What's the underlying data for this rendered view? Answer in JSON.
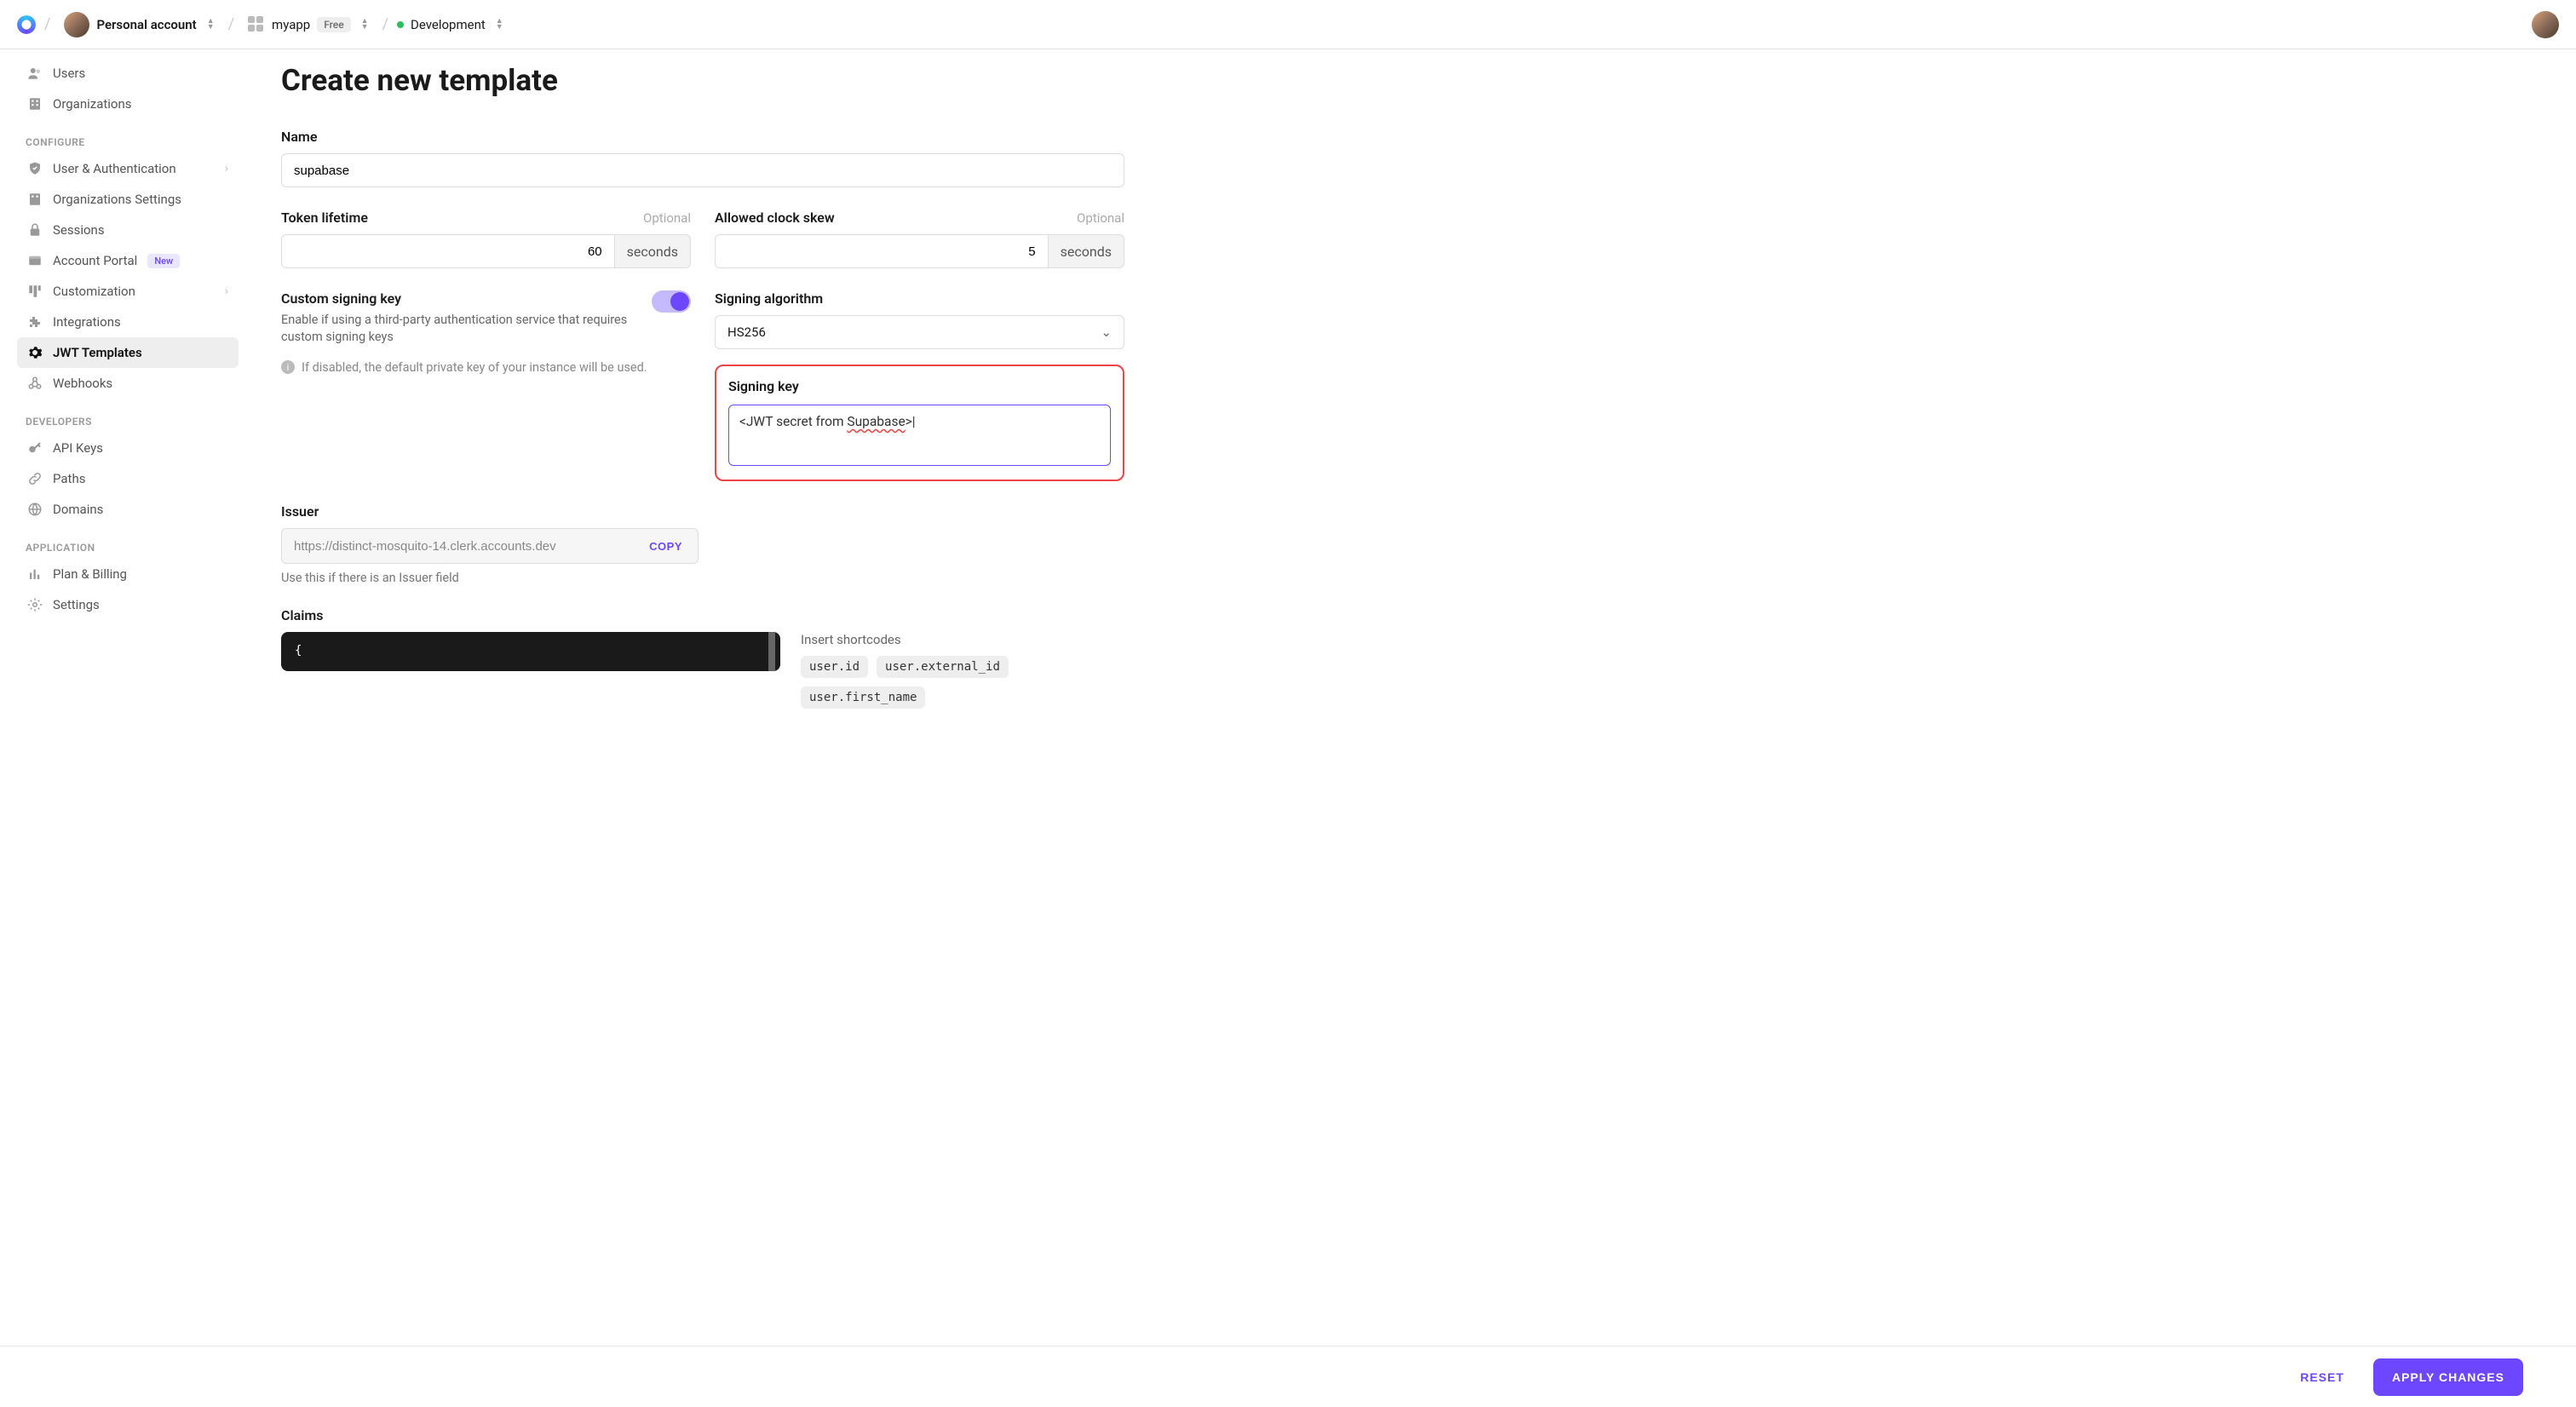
{
  "header": {
    "account_label": "Personal account",
    "app_name": "myapp",
    "app_plan": "Free",
    "environment": "Development"
  },
  "sidebar": {
    "top": [
      {
        "label": "Users",
        "icon": "users-icon"
      },
      {
        "label": "Organizations",
        "icon": "org-icon"
      }
    ],
    "configure_label": "CONFIGURE",
    "configure": [
      {
        "label": "User & Authentication",
        "icon": "shield-icon",
        "has_chevron": true
      },
      {
        "label": "Organizations Settings",
        "icon": "org-icon"
      },
      {
        "label": "Sessions",
        "icon": "lock-icon"
      },
      {
        "label": "Account Portal",
        "icon": "portal-icon",
        "badge": "New"
      },
      {
        "label": "Customization",
        "icon": "customize-icon",
        "has_chevron": true
      },
      {
        "label": "Integrations",
        "icon": "puzzle-icon"
      },
      {
        "label": "JWT Templates",
        "icon": "gear-icon",
        "active": true
      },
      {
        "label": "Webhooks",
        "icon": "webhook-icon"
      }
    ],
    "developers_label": "DEVELOPERS",
    "developers": [
      {
        "label": "API Keys",
        "icon": "key-icon"
      },
      {
        "label": "Paths",
        "icon": "link-icon"
      },
      {
        "label": "Domains",
        "icon": "globe-icon"
      }
    ],
    "application_label": "APPLICATION",
    "application": [
      {
        "label": "Plan & Billing",
        "icon": "billing-icon"
      },
      {
        "label": "Settings",
        "icon": "settings-icon"
      }
    ]
  },
  "page": {
    "title": "Create new template",
    "name_label": "Name",
    "name_value": "supabase",
    "token_lifetime_label": "Token lifetime",
    "token_lifetime_value": "60",
    "token_lifetime_unit": "seconds",
    "clock_skew_label": "Allowed clock skew",
    "clock_skew_value": "5",
    "clock_skew_unit": "seconds",
    "optional_label": "Optional",
    "custom_key_label": "Custom signing key",
    "custom_key_desc": "Enable if using a third-party authentication service that requires custom signing keys",
    "custom_key_info": "If disabled, the default private key of your instance will be used.",
    "algorithm_label": "Signing algorithm",
    "algorithm_value": "HS256",
    "signing_key_label": "Signing key",
    "signing_key_value_prefix": "<JWT secret from ",
    "signing_key_value_spell": "Supabase",
    "signing_key_value_suffix": ">",
    "issuer_label": "Issuer",
    "issuer_value": "https://distinct-mosquito-14.clerk.accounts.dev",
    "issuer_copy": "COPY",
    "issuer_helper": "Use this if there is an Issuer field",
    "claims_label": "Claims",
    "claims_code": "{",
    "shortcodes_label": "Insert shortcodes",
    "shortcodes": [
      "user.id",
      "user.external_id",
      "user.first_name"
    ]
  },
  "footer": {
    "reset": "RESET",
    "apply": "APPLY CHANGES"
  }
}
